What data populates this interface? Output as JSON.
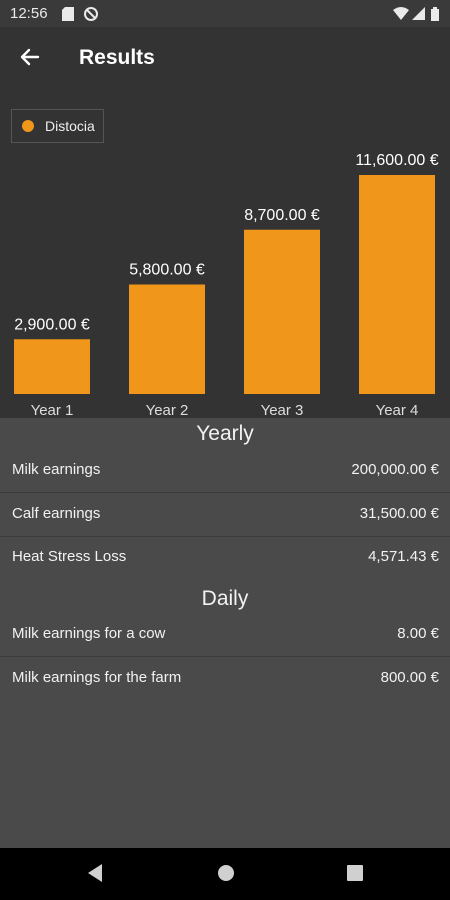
{
  "status_bar": {
    "time": "12:56",
    "icons": [
      "sd-card-icon",
      "no-data-icon",
      "wifi-icon",
      "signal-icon",
      "battery-icon"
    ]
  },
  "app_bar": {
    "title": "Results",
    "back_icon": "arrow-left-icon"
  },
  "colors": {
    "accent": "#f0961a",
    "background": "#4a4a4a",
    "header": "#333333"
  },
  "chart_data": {
    "type": "bar",
    "categories": [
      "Year 1",
      "Year 2",
      "Year 3",
      "Year 4"
    ],
    "series": [
      {
        "name": "Distocia",
        "values": [
          2900,
          5800,
          8700,
          11600
        ]
      }
    ],
    "value_labels": [
      "2,900.00 €",
      "5,800.00 €",
      "8,700.00 €",
      "11,600.00 €"
    ],
    "ylim": [
      0,
      11600
    ],
    "legend": "top-left",
    "grid": false
  },
  "yearly": {
    "title": "Yearly",
    "rows": [
      {
        "label": "Milk earnings",
        "value": "200,000.00 €"
      },
      {
        "label": "Calf earnings",
        "value": "31,500.00 €"
      },
      {
        "label": "Heat Stress Loss",
        "value": "4,571.43 €"
      }
    ]
  },
  "daily": {
    "title": "Daily",
    "rows": [
      {
        "label": "Milk earnings for a cow",
        "value": "8.00 €"
      },
      {
        "label": "Milk earnings for the farm",
        "value": "800.00 €"
      }
    ]
  },
  "nav_bar": {
    "buttons": [
      "back-triangle-icon",
      "home-circle-icon",
      "recents-square-icon"
    ]
  }
}
